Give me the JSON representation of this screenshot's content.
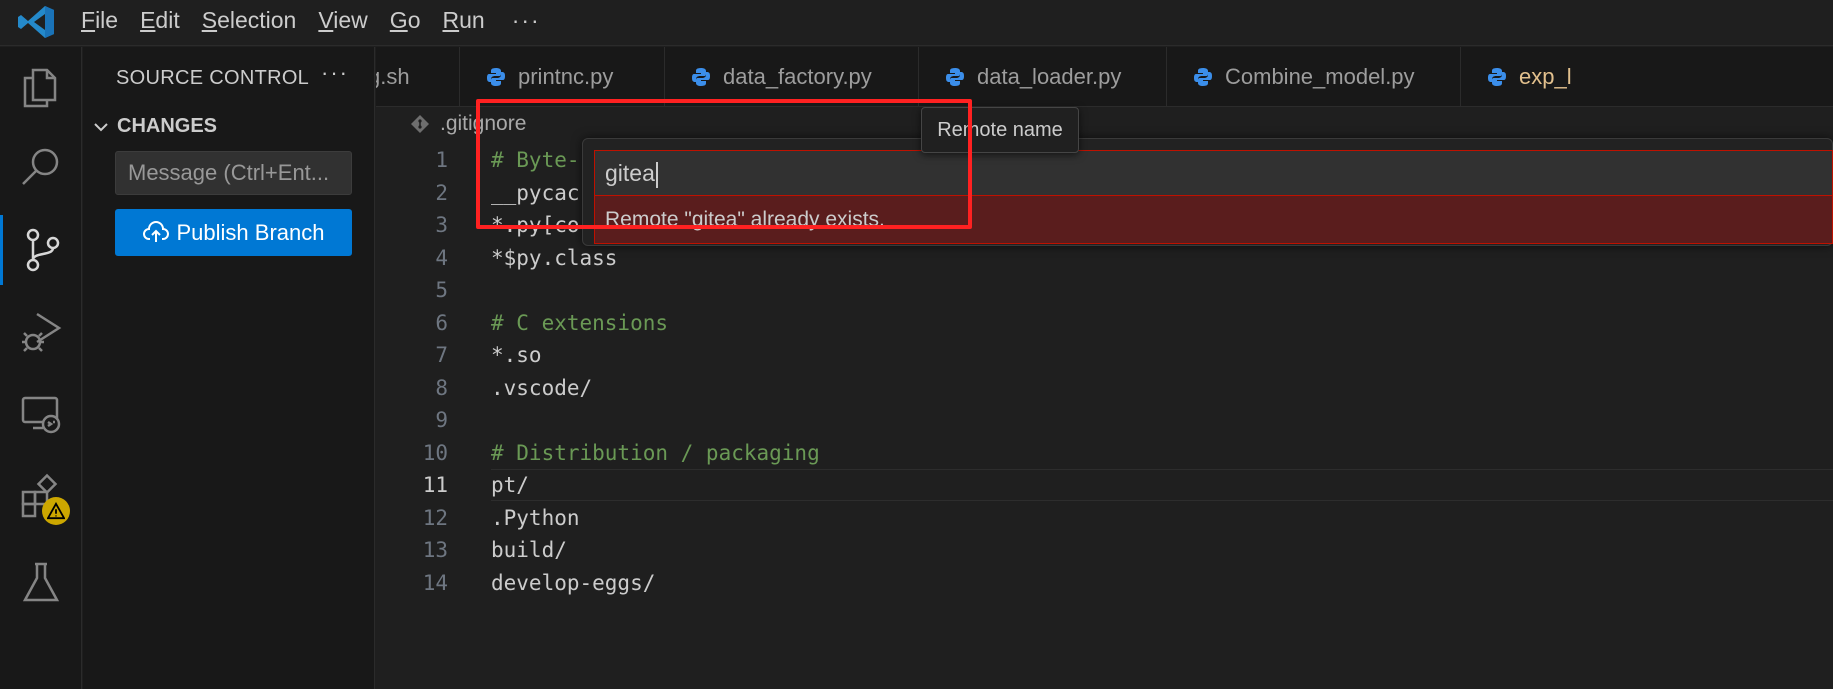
{
  "menu": {
    "items": [
      "File",
      "Edit",
      "Selection",
      "View",
      "Go",
      "Run"
    ],
    "more": "···"
  },
  "sidebar": {
    "title": "SOURCE CONTROL",
    "more": "···",
    "section": "CHANGES",
    "message_placeholder": "Message (Ctrl+Ent...",
    "publish_label": "Publish Branch"
  },
  "tabs": [
    {
      "label": "g.sh"
    },
    {
      "label": "printnc.py"
    },
    {
      "label": "data_factory.py"
    },
    {
      "label": "data_loader.py"
    },
    {
      "label": "Combine_model.py"
    },
    {
      "label": "exp_l"
    }
  ],
  "breadcrumb": {
    "file": ".gitignore"
  },
  "editor": {
    "lines": [
      {
        "n": "1",
        "text": "# Byte-",
        "comment": true
      },
      {
        "n": "2",
        "text": "__pycac",
        "comment": false
      },
      {
        "n": "3",
        "text": "*.py[co",
        "comment": false
      },
      {
        "n": "4",
        "text": "*$py.class",
        "comment": false
      },
      {
        "n": "5",
        "text": "",
        "comment": false
      },
      {
        "n": "6",
        "text": "# C extensions",
        "comment": true
      },
      {
        "n": "7",
        "text": "*.so",
        "comment": false
      },
      {
        "n": "8",
        "text": ".vscode/",
        "comment": false
      },
      {
        "n": "9",
        "text": "",
        "comment": false
      },
      {
        "n": "10",
        "text": "# Distribution / packaging",
        "comment": true
      },
      {
        "n": "11",
        "text": "pt/",
        "comment": false
      },
      {
        "n": "12",
        "text": ".Python",
        "comment": false
      },
      {
        "n": "13",
        "text": "build/",
        "comment": false
      },
      {
        "n": "14",
        "text": "develop-eggs/",
        "comment": false
      }
    ],
    "current_line": "11"
  },
  "quick_input": {
    "value": "gitea",
    "error": "Remote \"gitea\" already exists.",
    "tooltip": "Remote name"
  },
  "colors": {
    "accent": "#0078d4",
    "error_border": "#be1100",
    "error_bg": "#5a1d1d",
    "highlight": "#ff2121",
    "warning": "#cca700",
    "python_icon": "#3b8eea",
    "active_tab_text": "#e2c08d"
  },
  "icons": {
    "logo": "vscode-logo-icon",
    "activity": [
      "explorer-icon",
      "search-icon",
      "source-control-icon",
      "run-debug-icon",
      "remote-explorer-icon",
      "extensions-icon",
      "testing-icon"
    ]
  }
}
